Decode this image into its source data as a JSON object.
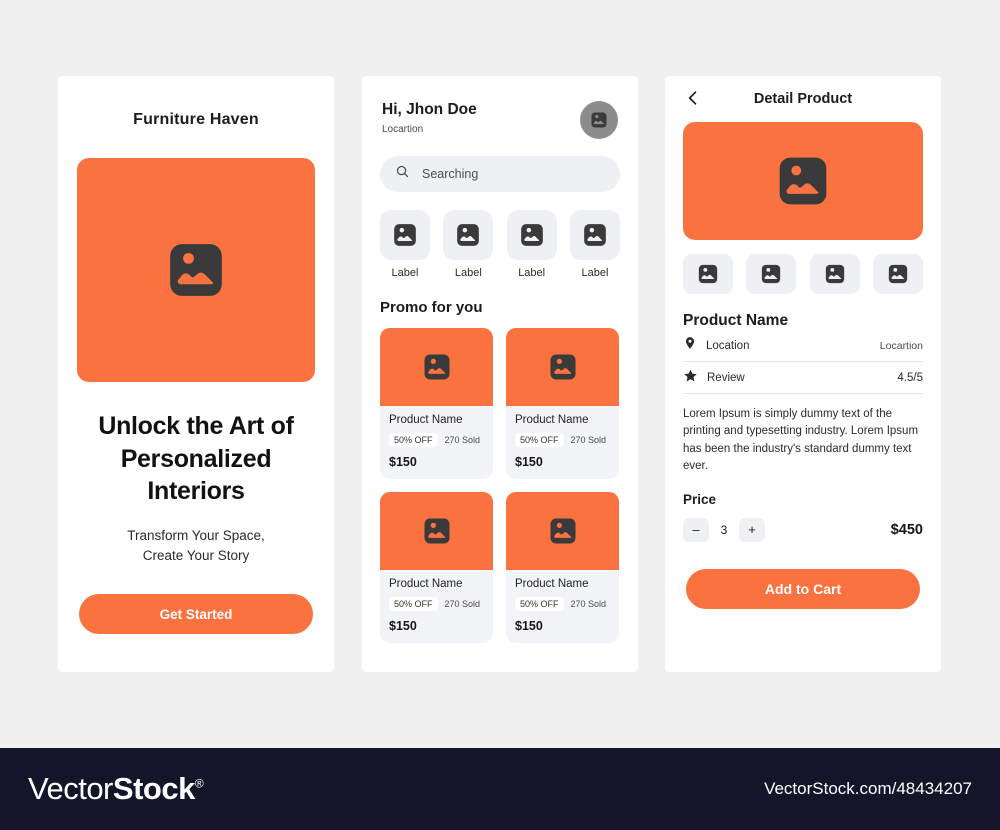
{
  "page": {
    "background": "#f0f0f0",
    "accent": "#fa7240"
  },
  "screen1": {
    "app_title": "Furniture Haven",
    "hero_icon": "image-placeholder-icon",
    "headline": "Unlock the Art of Personalized Interiors",
    "subtitle_line1": "Transform Your Space,",
    "subtitle_line2": "Create Your Story",
    "cta_label": "Get Started"
  },
  "screen2": {
    "greeting": "Hi, Jhon Doe",
    "location": "Locartion",
    "avatar_icon": "image-placeholder-icon",
    "search": {
      "placeholder": "Searching",
      "icon": "search-icon"
    },
    "categories": [
      {
        "label": "Label",
        "icon": "image-placeholder-icon"
      },
      {
        "label": "Label",
        "icon": "image-placeholder-icon"
      },
      {
        "label": "Label",
        "icon": "image-placeholder-icon"
      },
      {
        "label": "Label",
        "icon": "image-placeholder-icon"
      }
    ],
    "section_title": "Promo for you",
    "products": [
      {
        "name": "Product Name",
        "discount": "50% OFF",
        "sold": "270 Sold",
        "price": "$150"
      },
      {
        "name": "Product Name",
        "discount": "50% OFF",
        "sold": "270 Sold",
        "price": "$150"
      },
      {
        "name": "Product Name",
        "discount": "50% OFF",
        "sold": "270 Sold",
        "price": "$150"
      },
      {
        "name": "Product Name",
        "discount": "50% OFF",
        "sold": "270 Sold",
        "price": "$150"
      }
    ]
  },
  "screen3": {
    "back_icon": "chevron-left-icon",
    "title": "Detail Product",
    "hero_icon": "image-placeholder-icon",
    "thumbnails": [
      {
        "icon": "image-placeholder-icon"
      },
      {
        "icon": "image-placeholder-icon"
      },
      {
        "icon": "image-placeholder-icon"
      },
      {
        "icon": "image-placeholder-icon"
      }
    ],
    "product_name": "Product Name",
    "location_row": {
      "icon": "map-pin-icon",
      "label": "Location",
      "value": "Locartion"
    },
    "review_row": {
      "icon": "star-icon",
      "label": "Review",
      "value": "4.5/5"
    },
    "description": "Lorem Ipsum is simply dummy text of the printing and typesetting industry. Lorem Ipsum has been the industry's standard dummy text ever.",
    "price_label": "Price",
    "quantity": {
      "decrement": "–",
      "value": "3",
      "increment": "+"
    },
    "total_price": "$450",
    "cart_label": "Add to Cart"
  },
  "footer": {
    "logo_light": "Vector",
    "logo_bold": "Stock",
    "logo_mark": "®",
    "url": "VectorStock.com/48434207"
  }
}
